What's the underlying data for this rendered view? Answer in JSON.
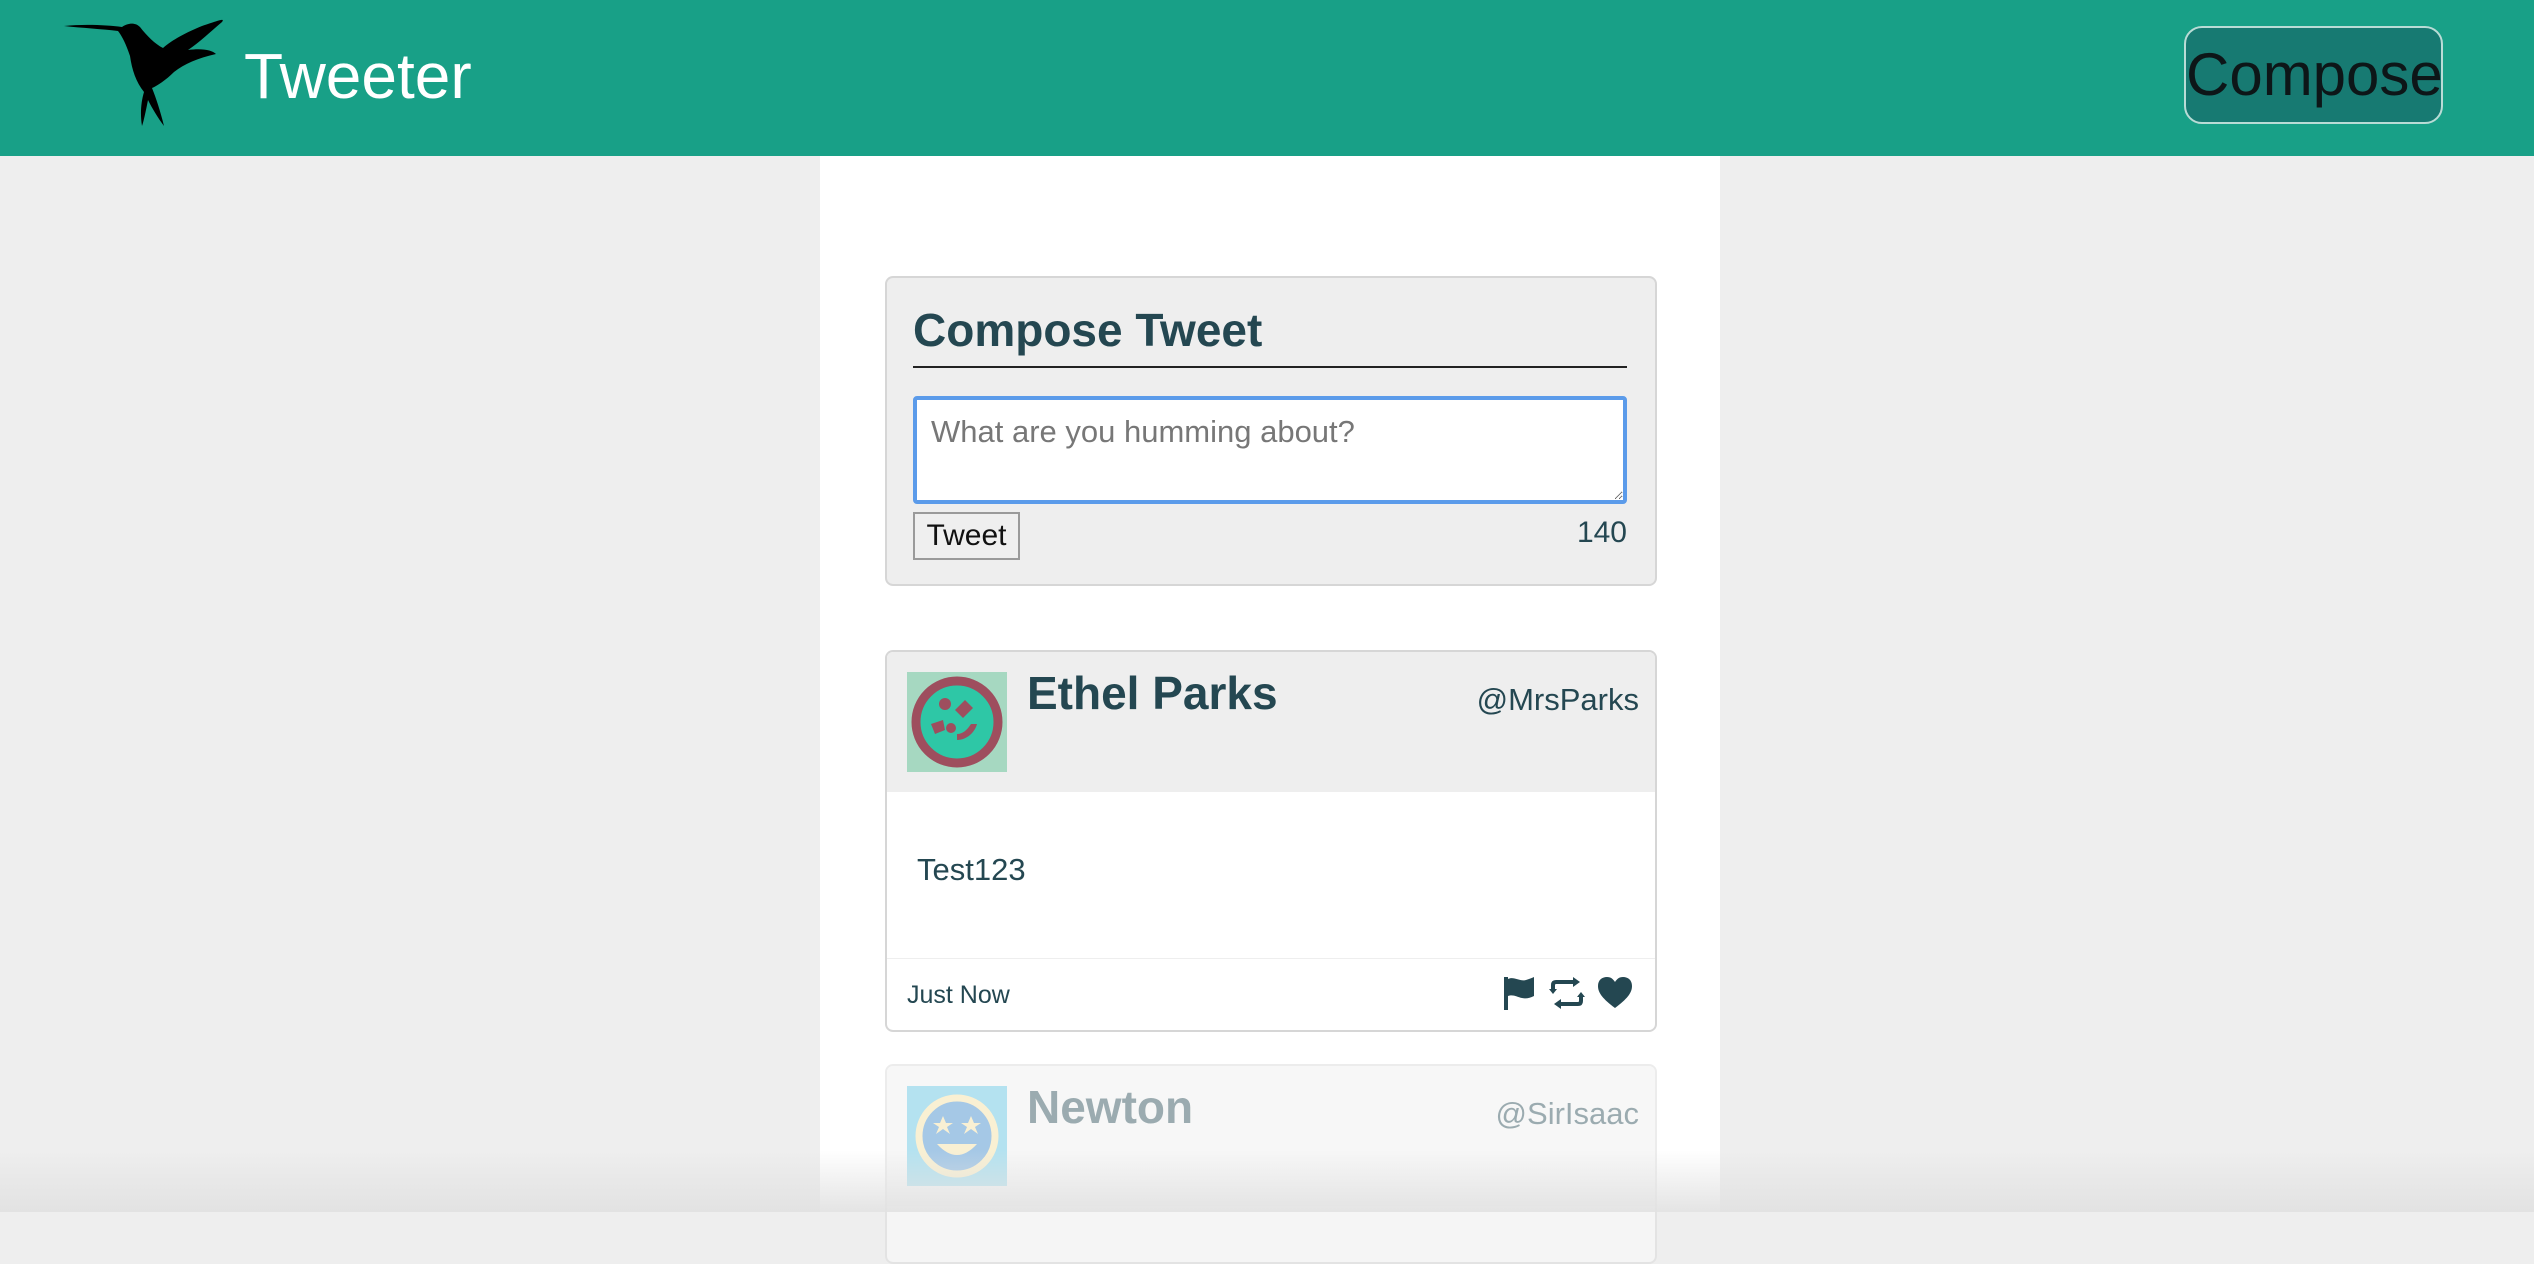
{
  "nav": {
    "brand": "Tweeter",
    "compose_label": "Compose"
  },
  "compose": {
    "title": "Compose Tweet",
    "placeholder": "What are you humming about?",
    "button_label": "Tweet",
    "char_count": "140"
  },
  "tweets": [
    {
      "name": "Ethel Parks",
      "handle": "@MrsParks",
      "text": "Test123",
      "time": "Just Now",
      "actions": [
        "flag-icon",
        "retweet-icon",
        "heart-icon"
      ]
    },
    {
      "name": "Newton",
      "handle": "@SirIsaac"
    }
  ],
  "colors": {
    "nav": "#18a087",
    "compose_button": "#177a72",
    "text": "#244751",
    "page_bg": "#eeeeee",
    "focus_ring": "#5b9bea"
  }
}
